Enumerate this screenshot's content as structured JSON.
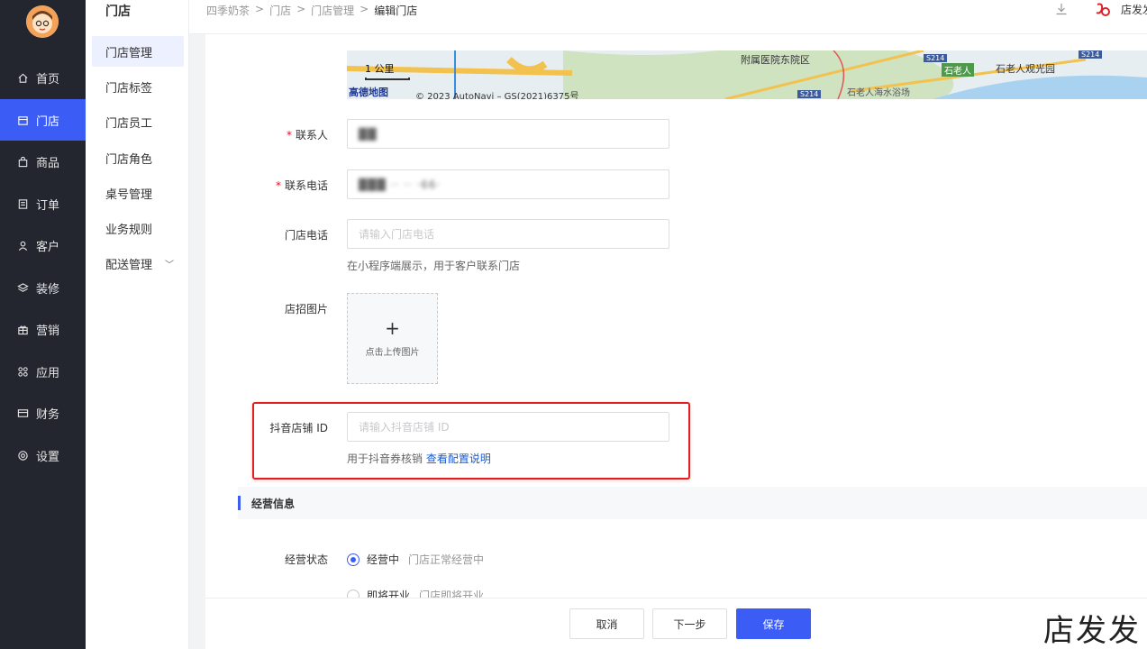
{
  "nav": {
    "items": [
      {
        "label": "首页",
        "icon": "home-icon"
      },
      {
        "label": "门店",
        "icon": "store-icon",
        "active": true
      },
      {
        "label": "商品",
        "icon": "bag-icon"
      },
      {
        "label": "订单",
        "icon": "order-icon"
      },
      {
        "label": "客户",
        "icon": "user-icon"
      },
      {
        "label": "装修",
        "icon": "layers-icon"
      },
      {
        "label": "营销",
        "icon": "gift-icon"
      },
      {
        "label": "应用",
        "icon": "apps-icon"
      },
      {
        "label": "财务",
        "icon": "card-icon"
      },
      {
        "label": "设置",
        "icon": "gear-icon"
      }
    ]
  },
  "subnav": {
    "title": "门店",
    "items": [
      "门店管理",
      "门店标签",
      "门店员工",
      "门店角色",
      "桌号管理",
      "业务规则",
      "配送管理"
    ]
  },
  "breadcrumb": [
    "四季奶茶",
    "门店",
    "门店管理",
    "编辑门店"
  ],
  "top": {
    "brand": "店发发"
  },
  "map": {
    "scale": "1 公里",
    "logo": "高德地图",
    "copyright": "© 2023 AutoNavi – GS(2021)6375号",
    "label_hospital": "附属医院东院区",
    "label_park": "石老人观光园",
    "label_stone": "石老人",
    "label_beach": "石老人海水浴场",
    "road": "S214"
  },
  "form": {
    "contact_label": "联系人",
    "contact_value": "██",
    "phone_label": "联系电话",
    "phone_value": "███ ·· ·· ·66·",
    "store_phone_label": "门店电话",
    "store_phone_placeholder": "请输入门店电话",
    "store_phone_help": "在小程序端展示，用于客户联系门店",
    "sign_label": "店招图片",
    "upload_text": "点击上传图片",
    "douyin_label": "抖音店铺 ID",
    "douyin_placeholder": "请输入抖音店铺 ID",
    "douyin_help": "用于抖音券核销",
    "douyin_link": "查看配置说明"
  },
  "business": {
    "section_title": "经营信息",
    "status_label": "经营状态",
    "opt1": "经营中",
    "opt1_desc": "门店正常经营中",
    "opt2": "即将开业",
    "opt2_desc": "门店即将开业"
  },
  "footer": {
    "cancel": "取消",
    "next": "下一步",
    "save": "保存"
  },
  "watermark": "店发发",
  "colors": {
    "accent": "#3b5cf5",
    "nav_bg": "#23262f",
    "highlight": "#e02020"
  }
}
